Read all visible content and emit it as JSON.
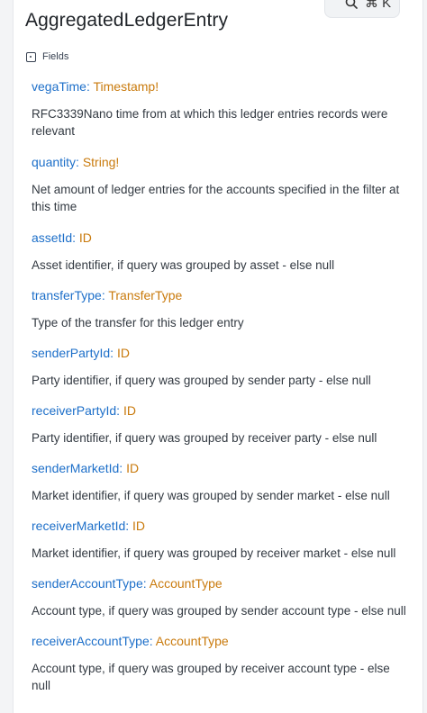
{
  "search": {
    "shortcut": "⌘ K"
  },
  "page_title": "AggregatedLedgerEntry",
  "fields_label": "Fields",
  "fields": [
    {
      "name": "vegaTime",
      "type": "Timestamp",
      "bang": "!",
      "description": "RFC3339Nano time from at which this ledger entries records were relevant"
    },
    {
      "name": "quantity",
      "type": "String",
      "bang": "!",
      "description": "Net amount of ledger entries for the accounts specified in the filter at this time"
    },
    {
      "name": "assetId",
      "type": "ID",
      "bang": "",
      "description": "Asset identifier, if query was grouped by asset - else null"
    },
    {
      "name": "transferType",
      "type": "TransferType",
      "bang": "",
      "description": "Type of the transfer for this ledger entry"
    },
    {
      "name": "senderPartyId",
      "type": "ID",
      "bang": "",
      "description": "Party identifier, if query was grouped by sender party - else null"
    },
    {
      "name": "receiverPartyId",
      "type": "ID",
      "bang": "",
      "description": "Party identifier, if query was grouped by receiver party - else null"
    },
    {
      "name": "senderMarketId",
      "type": "ID",
      "bang": "",
      "description": "Market identifier, if query was grouped by sender market - else null"
    },
    {
      "name": "receiverMarketId",
      "type": "ID",
      "bang": "",
      "description": "Market identifier, if query was grouped by receiver market - else null"
    },
    {
      "name": "senderAccountType",
      "type": "AccountType",
      "bang": "",
      "description": "Account type, if query was grouped by sender account type - else null"
    },
    {
      "name": "receiverAccountType",
      "type": "AccountType",
      "bang": "",
      "description": "Account type, if query was grouped by receiver account type - else null"
    }
  ]
}
